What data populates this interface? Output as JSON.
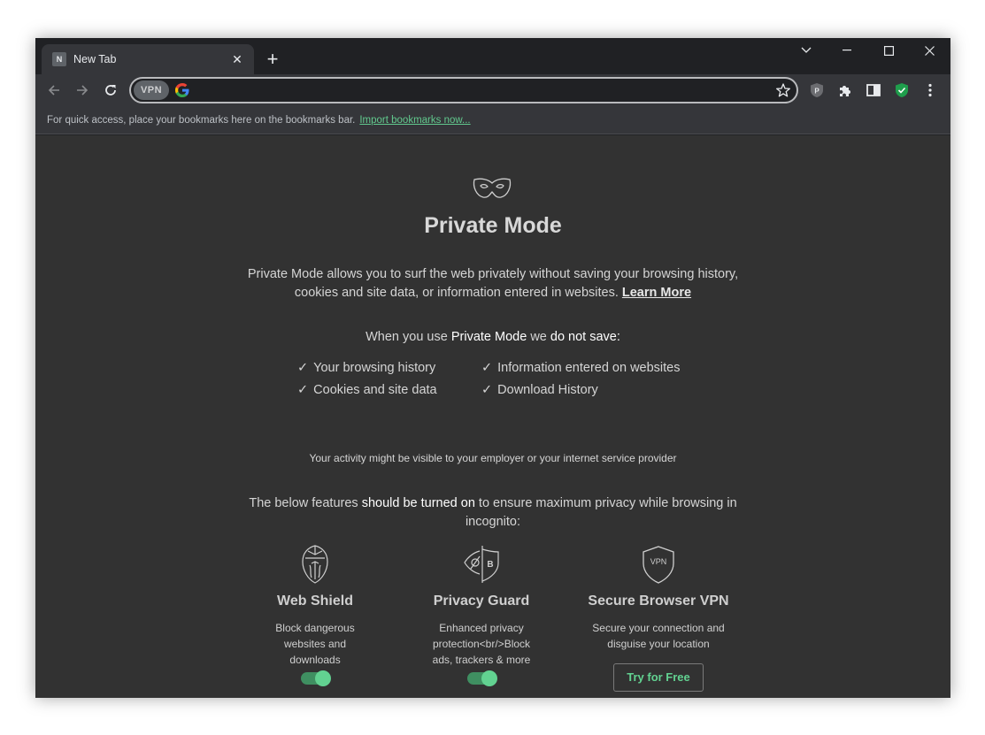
{
  "tab": {
    "favicon_letter": "N",
    "title": "New Tab",
    "close": "✕"
  },
  "newtab": "+",
  "omnibox": {
    "vpn_label": "VPN",
    "placeholder": "",
    "value": ""
  },
  "bookmarks": {
    "text": "For quick access, place your bookmarks here on the bookmarks bar.",
    "link": "Import bookmarks now..."
  },
  "main": {
    "title": "Private Mode",
    "description": "Private Mode allows you to surf the web privately without saving your browsing history, cookies and site data, or information entered in websites.",
    "learn_more": "Learn More",
    "when_prefix": "When you use",
    "when_bold": "Private Mode",
    "when_mid": "we",
    "when_bold2": "do not save:",
    "checks": [
      "Your browsing history",
      "Information entered on websites",
      "Cookies and site data",
      "Download History"
    ],
    "check_mark": "✓",
    "activity": "Your activity might be visible to your employer or your internet service provider",
    "below_prefix": "The below features",
    "below_bold": "should be turned on",
    "below_suffix": "to ensure maximum privacy while browsing in incognito:"
  },
  "features": [
    {
      "title": "Web Shield",
      "desc_lines": [
        "Block dangerous",
        "websites and",
        "downloads"
      ],
      "toggle_on": true
    },
    {
      "title": "Privacy Guard",
      "desc_lines": [
        "Enhanced privacy",
        "protection<br/>Block",
        "ads, trackers & more"
      ],
      "toggle_on": true
    },
    {
      "title": "Secure Browser VPN",
      "desc_lines": [
        "Secure your connection and",
        "disguise your location"
      ],
      "button": "Try for Free",
      "icon_text": "VPN"
    }
  ],
  "privacy_icon_letter": "B",
  "colors": {
    "accent": "#62d291",
    "content_bg": "#323232",
    "toolbar_bg": "#35363a",
    "frame_bg": "#202124"
  }
}
